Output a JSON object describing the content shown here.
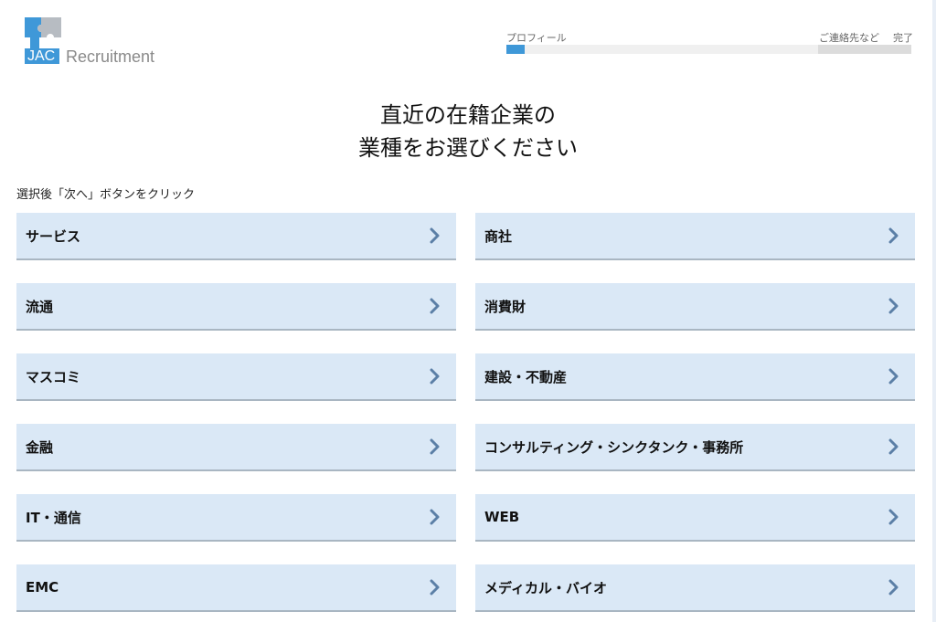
{
  "brand": {
    "mark": "JAC",
    "name": "Recruitment",
    "colors": {
      "blue": "#3f98d8",
      "grey": "#8a8a8a"
    }
  },
  "progress": {
    "steps": [
      "プロフィール",
      "ご連絡先など",
      "完了"
    ],
    "fraction": 0.045
  },
  "heading": {
    "line1": "直近の在籍企業の",
    "line2": "業種をお選びください"
  },
  "instruction": "選択後「次へ」ボタンをクリック",
  "industries": [
    "サービス",
    "商社",
    "流通",
    "消費財",
    "マスコミ",
    "建設・不動産",
    "金融",
    "コンサルティング・シンクタンク・事務所",
    "IT・通信",
    "WEB",
    "EMC",
    "メディカル・バイオ"
  ],
  "icons": {
    "chevron": "chevron-right-icon"
  },
  "colors": {
    "card_bg": "#dae8f6",
    "chevron": "#5b7fa6"
  }
}
